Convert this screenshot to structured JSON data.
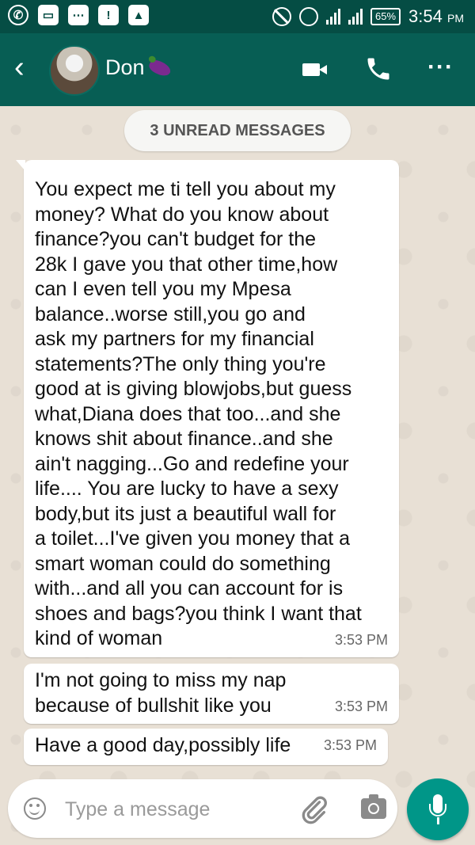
{
  "status_bar": {
    "battery": "65%",
    "time": "3:54",
    "time_suffix": "PM",
    "notification_icons": [
      "whatsapp-icon",
      "gallery-icon",
      "messages-icon",
      "alert-icon",
      "upload-icon"
    ]
  },
  "header": {
    "contact_name": "Don",
    "back_icon": "chevron-left-icon",
    "actions": [
      "video-call-icon",
      "voice-call-icon",
      "more-options-icon"
    ],
    "colors": {
      "header": "#075e54",
      "status_bar": "#054d44"
    }
  },
  "chat": {
    "unread_banner": "3 UNREAD MESSAGES",
    "messages": [
      {
        "text": "You expect me ti tell you about my\nmoney? What do you know about\nfinance?you can't budget for the\n28k I gave you that other time,how\ncan I even tell you my Mpesa\nbalance..worse still,you go and\nask my partners for my financial\nstatements?The only thing you're\ngood at is giving blowjobs,but guess\nwhat,Diana does that too...and she\nknows shit about finance..and she\nain't nagging...Go and redefine your\nlife.... You are lucky to have a sexy\nbody,but its just a beautiful wall for\na toilet...I've given you money that a\nsmart woman could do something\nwith...and all you can account for is\nshoes and bags?you think I want that\nkind of woman",
        "time": "3:53 PM"
      },
      {
        "text": "I'm not going to miss my nap\nbecause of bullshit like you",
        "time": "3:53 PM"
      },
      {
        "text": "Have a good day,possibly life",
        "time": "3:53 PM"
      }
    ]
  },
  "composer": {
    "placeholder": "Type a message",
    "icons": [
      "emoji-icon",
      "attachment-icon",
      "camera-icon",
      "microphone-icon"
    ],
    "mic_color": "#009688"
  }
}
